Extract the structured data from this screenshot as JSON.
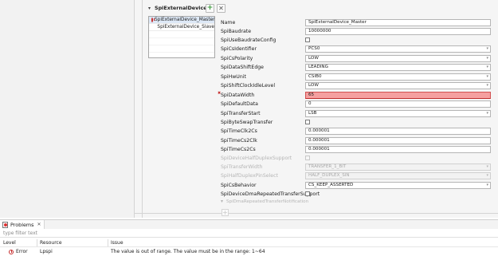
{
  "section": {
    "title": "SpiExternalDevice",
    "add_label": "+",
    "remove_label": "✕"
  },
  "instances": [
    {
      "label": "SpiExternalDevice_Master",
      "has_error": true
    },
    {
      "label": "SpiExternalDevice_Slave",
      "has_error": false
    }
  ],
  "properties": {
    "name": {
      "label": "Name",
      "value": "SpiExternalDevice_Master"
    },
    "baudrate": {
      "label": "SpiBaudrate",
      "value": "10000000"
    },
    "use_baudrate_config": {
      "label": "SpiUseBaudrateConfig"
    },
    "cs_identifier": {
      "label": "SpiCsIdentifier",
      "value": "PCS0"
    },
    "cs_polarity": {
      "label": "SpiCsPolarity",
      "value": "LOW"
    },
    "data_shift_edge": {
      "label": "SpiDataShiftEdge",
      "value": "LEADING"
    },
    "hw_unit": {
      "label": "SpiHwUnit",
      "value": "CSIB0"
    },
    "shift_clock_idle_level": {
      "label": "SpiShiftClockIdleLevel",
      "value": "LOW"
    },
    "data_width": {
      "label": "SpiDataWidth",
      "value": "65"
    },
    "default_data": {
      "label": "SpiDefaultData",
      "value": "0"
    },
    "transfer_start": {
      "label": "SpiTransferStart",
      "value": "LSB"
    },
    "byte_swap_transfer": {
      "label": "SpiByteSwapTransfer"
    },
    "time_clk2cs": {
      "label": "SpiTimeClk2Cs",
      "value": "0.000001"
    },
    "time_cs2clk": {
      "label": "SpiTimeCs2Clk",
      "value": "0.000001"
    },
    "time_cs2cs": {
      "label": "SpiTimeCs2Cs",
      "value": "0.000001"
    },
    "device_half_duplex_support": {
      "label": "SpiDeviceHalfDuplexSupport"
    },
    "transfer_width": {
      "label": "SpiTransferWidth",
      "value": "TRANSFER_1_BIT"
    },
    "half_duplex_pin_select": {
      "label": "SpiHalfDuplexPinSelect",
      "value": "HALF_DUPLEX_SIN"
    },
    "cs_behavior": {
      "label": "SpiCsBehavior",
      "value": "CS_KEEP_ASSERTED"
    },
    "device_dma_repeated_transfer_support": {
      "label": "SpiDeviceDmaRepeatedTransferSupport"
    },
    "dma_repeated_transfer_notification": {
      "label": "SpiDmaRepeatedTransferNotification"
    }
  },
  "problems": {
    "tab_label": "Problems",
    "close_label": "✕",
    "filter_placeholder": "type filter text",
    "columns": {
      "level": "Level",
      "resource": "Resource",
      "issue": "Issue"
    },
    "rows": [
      {
        "level": "Error",
        "resource": "Lpspi",
        "issue": "The value is out of range. The value must be in the range: 1~64"
      }
    ]
  },
  "colors": {
    "error_fill": "#f5a0a0",
    "error_icon": "#c52a2a",
    "add_icon": "#3a9a3a",
    "selection": "#dde8f6"
  }
}
